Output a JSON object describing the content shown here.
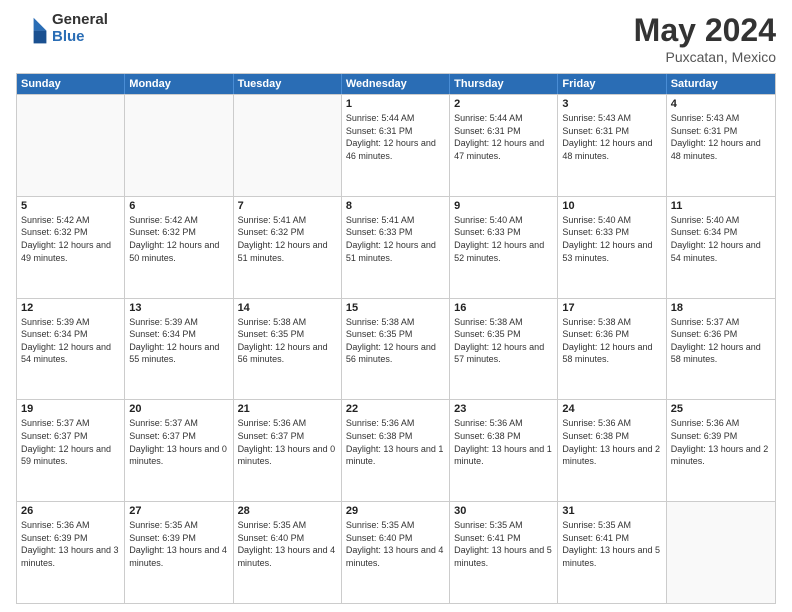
{
  "logo": {
    "general": "General",
    "blue": "Blue"
  },
  "title": "May 2024",
  "subtitle": "Puxcatan, Mexico",
  "days_of_week": [
    "Sunday",
    "Monday",
    "Tuesday",
    "Wednesday",
    "Thursday",
    "Friday",
    "Saturday"
  ],
  "weeks": [
    [
      {
        "day": "",
        "sunrise": "",
        "sunset": "",
        "daylight": "",
        "empty": true
      },
      {
        "day": "",
        "sunrise": "",
        "sunset": "",
        "daylight": "",
        "empty": true
      },
      {
        "day": "",
        "sunrise": "",
        "sunset": "",
        "daylight": "",
        "empty": true
      },
      {
        "day": "1",
        "sunrise": "Sunrise: 5:44 AM",
        "sunset": "Sunset: 6:31 PM",
        "daylight": "Daylight: 12 hours and 46 minutes."
      },
      {
        "day": "2",
        "sunrise": "Sunrise: 5:44 AM",
        "sunset": "Sunset: 6:31 PM",
        "daylight": "Daylight: 12 hours and 47 minutes."
      },
      {
        "day": "3",
        "sunrise": "Sunrise: 5:43 AM",
        "sunset": "Sunset: 6:31 PM",
        "daylight": "Daylight: 12 hours and 48 minutes."
      },
      {
        "day": "4",
        "sunrise": "Sunrise: 5:43 AM",
        "sunset": "Sunset: 6:31 PM",
        "daylight": "Daylight: 12 hours and 48 minutes."
      }
    ],
    [
      {
        "day": "5",
        "sunrise": "Sunrise: 5:42 AM",
        "sunset": "Sunset: 6:32 PM",
        "daylight": "Daylight: 12 hours and 49 minutes."
      },
      {
        "day": "6",
        "sunrise": "Sunrise: 5:42 AM",
        "sunset": "Sunset: 6:32 PM",
        "daylight": "Daylight: 12 hours and 50 minutes."
      },
      {
        "day": "7",
        "sunrise": "Sunrise: 5:41 AM",
        "sunset": "Sunset: 6:32 PM",
        "daylight": "Daylight: 12 hours and 51 minutes."
      },
      {
        "day": "8",
        "sunrise": "Sunrise: 5:41 AM",
        "sunset": "Sunset: 6:33 PM",
        "daylight": "Daylight: 12 hours and 51 minutes."
      },
      {
        "day": "9",
        "sunrise": "Sunrise: 5:40 AM",
        "sunset": "Sunset: 6:33 PM",
        "daylight": "Daylight: 12 hours and 52 minutes."
      },
      {
        "day": "10",
        "sunrise": "Sunrise: 5:40 AM",
        "sunset": "Sunset: 6:33 PM",
        "daylight": "Daylight: 12 hours and 53 minutes."
      },
      {
        "day": "11",
        "sunrise": "Sunrise: 5:40 AM",
        "sunset": "Sunset: 6:34 PM",
        "daylight": "Daylight: 12 hours and 54 minutes."
      }
    ],
    [
      {
        "day": "12",
        "sunrise": "Sunrise: 5:39 AM",
        "sunset": "Sunset: 6:34 PM",
        "daylight": "Daylight: 12 hours and 54 minutes."
      },
      {
        "day": "13",
        "sunrise": "Sunrise: 5:39 AM",
        "sunset": "Sunset: 6:34 PM",
        "daylight": "Daylight: 12 hours and 55 minutes."
      },
      {
        "day": "14",
        "sunrise": "Sunrise: 5:38 AM",
        "sunset": "Sunset: 6:35 PM",
        "daylight": "Daylight: 12 hours and 56 minutes."
      },
      {
        "day": "15",
        "sunrise": "Sunrise: 5:38 AM",
        "sunset": "Sunset: 6:35 PM",
        "daylight": "Daylight: 12 hours and 56 minutes."
      },
      {
        "day": "16",
        "sunrise": "Sunrise: 5:38 AM",
        "sunset": "Sunset: 6:35 PM",
        "daylight": "Daylight: 12 hours and 57 minutes."
      },
      {
        "day": "17",
        "sunrise": "Sunrise: 5:38 AM",
        "sunset": "Sunset: 6:36 PM",
        "daylight": "Daylight: 12 hours and 58 minutes."
      },
      {
        "day": "18",
        "sunrise": "Sunrise: 5:37 AM",
        "sunset": "Sunset: 6:36 PM",
        "daylight": "Daylight: 12 hours and 58 minutes."
      }
    ],
    [
      {
        "day": "19",
        "sunrise": "Sunrise: 5:37 AM",
        "sunset": "Sunset: 6:37 PM",
        "daylight": "Daylight: 12 hours and 59 minutes."
      },
      {
        "day": "20",
        "sunrise": "Sunrise: 5:37 AM",
        "sunset": "Sunset: 6:37 PM",
        "daylight": "Daylight: 13 hours and 0 minutes."
      },
      {
        "day": "21",
        "sunrise": "Sunrise: 5:36 AM",
        "sunset": "Sunset: 6:37 PM",
        "daylight": "Daylight: 13 hours and 0 minutes."
      },
      {
        "day": "22",
        "sunrise": "Sunrise: 5:36 AM",
        "sunset": "Sunset: 6:38 PM",
        "daylight": "Daylight: 13 hours and 1 minute."
      },
      {
        "day": "23",
        "sunrise": "Sunrise: 5:36 AM",
        "sunset": "Sunset: 6:38 PM",
        "daylight": "Daylight: 13 hours and 1 minute."
      },
      {
        "day": "24",
        "sunrise": "Sunrise: 5:36 AM",
        "sunset": "Sunset: 6:38 PM",
        "daylight": "Daylight: 13 hours and 2 minutes."
      },
      {
        "day": "25",
        "sunrise": "Sunrise: 5:36 AM",
        "sunset": "Sunset: 6:39 PM",
        "daylight": "Daylight: 13 hours and 2 minutes."
      }
    ],
    [
      {
        "day": "26",
        "sunrise": "Sunrise: 5:36 AM",
        "sunset": "Sunset: 6:39 PM",
        "daylight": "Daylight: 13 hours and 3 minutes."
      },
      {
        "day": "27",
        "sunrise": "Sunrise: 5:35 AM",
        "sunset": "Sunset: 6:39 PM",
        "daylight": "Daylight: 13 hours and 4 minutes."
      },
      {
        "day": "28",
        "sunrise": "Sunrise: 5:35 AM",
        "sunset": "Sunset: 6:40 PM",
        "daylight": "Daylight: 13 hours and 4 minutes."
      },
      {
        "day": "29",
        "sunrise": "Sunrise: 5:35 AM",
        "sunset": "Sunset: 6:40 PM",
        "daylight": "Daylight: 13 hours and 4 minutes."
      },
      {
        "day": "30",
        "sunrise": "Sunrise: 5:35 AM",
        "sunset": "Sunset: 6:41 PM",
        "daylight": "Daylight: 13 hours and 5 minutes."
      },
      {
        "day": "31",
        "sunrise": "Sunrise: 5:35 AM",
        "sunset": "Sunset: 6:41 PM",
        "daylight": "Daylight: 13 hours and 5 minutes."
      },
      {
        "day": "",
        "sunrise": "",
        "sunset": "",
        "daylight": "",
        "empty": true
      }
    ]
  ]
}
